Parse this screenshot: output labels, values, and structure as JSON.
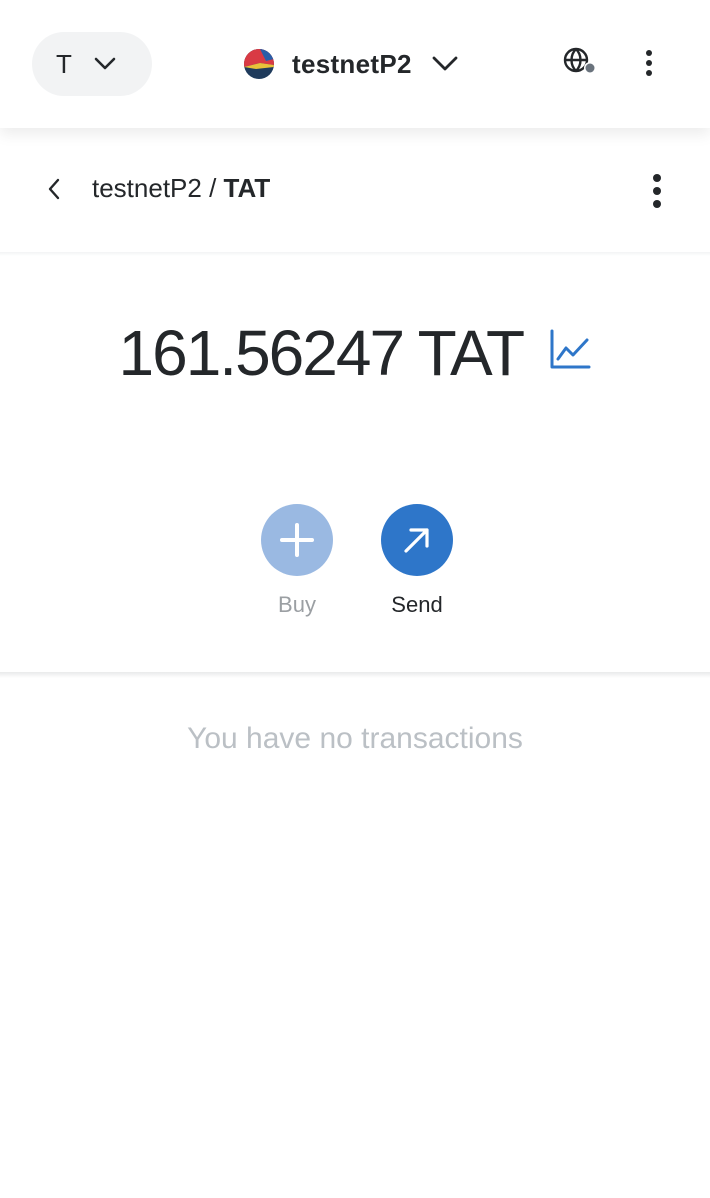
{
  "header": {
    "network_letter": "T",
    "account_name": "testnetP2"
  },
  "subheader": {
    "breadcrumb_account": "testnetP2",
    "breadcrumb_separator": " / ",
    "breadcrumb_token": "TAT"
  },
  "balance": {
    "amount": "161.56247",
    "symbol": "TAT",
    "display": "161.56247 TAT"
  },
  "actions": [
    {
      "label": "Buy",
      "icon": "plus-icon",
      "enabled": false
    },
    {
      "label": "Send",
      "icon": "arrow-up-right-icon",
      "enabled": true
    }
  ],
  "transactions": {
    "empty_message": "You have no transactions"
  },
  "colors": {
    "accent": "#2e76c9",
    "accent_disabled": "#9ab9e2",
    "text": "#24272a",
    "muted": "#bbc0c5"
  }
}
